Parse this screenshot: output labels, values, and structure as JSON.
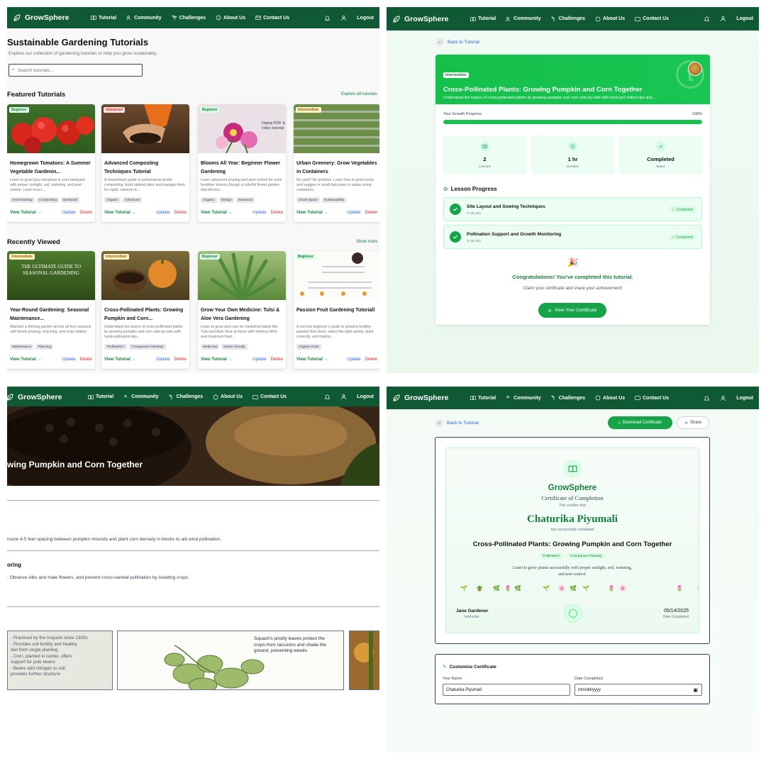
{
  "nav": {
    "brand": "GrowSphere",
    "links": [
      "Tutorial",
      "Community",
      "Challenges",
      "About Us",
      "Contact Us"
    ],
    "logout": "Logout"
  },
  "tutorials_page": {
    "title": "Sustainable Gardening Tutorials",
    "subtitle": "Explore our collection of gardening tutorials to help you grow sustainably.",
    "search_placeholder": "Search tutorials...",
    "featured": {
      "title": "Featured Tutorials",
      "link": "Explore all tutorials",
      "cards": [
        {
          "badge": "Beginner",
          "title": "Homegrown Tomatoes: A Summer Vegetable Gardenin...",
          "desc": "Learn to grow juicy tomatoes in your backyard with proper sunlight, soil, watering, and pest control. Learn how t...",
          "tags": [
            "Seed-starting",
            "Composting",
            "Backyard"
          ]
        },
        {
          "badge": "Advanced",
          "title": "Advanced Composting Techniques Tutorial",
          "desc": "A streamlined guide to professional-grade composting: build optimal piles and manage them for rapid, nutrient-ric...",
          "tags": [
            "Organic",
            "Advanced"
          ]
        },
        {
          "badge": "Beginner",
          "title": "Blooms All Year: Beginner Flower Gardening",
          "desc": "Learn advanced pruning and pest control for even healthier blooms.Design a colorful flower garden that blooms...",
          "tags": [
            "Organic",
            "Design",
            "Seasonal"
          ],
          "image_text": "Digital PDF & video tutorial"
        },
        {
          "badge": "Intermediate",
          "title": "Urban Greenery: Grow Vegetables in Containers",
          "desc": "No yard? No problem. Learn how to grow herbs and veggies in small balconies or patios using containers.",
          "tags": [
            "Small Space",
            "Sustainability"
          ]
        }
      ]
    },
    "recent": {
      "title": "Recently Viewed",
      "link": "Show more",
      "cards": [
        {
          "badge": "Intermediate",
          "title": "Year-Round Gardening: Seasonal Maintenance...",
          "desc": "Maintain a thriving garden across all four seasons with timely pruning, mulching, and crop rotation",
          "tags": [
            "Maintenance",
            "Planning"
          ],
          "image_text": "THE ULTIMATE GUIDE TO SEASONAL GARDENING"
        },
        {
          "badge": "Intermediate",
          "title": "Cross-Pollinated Plants: Growing Pumpkin and Corn...",
          "desc": "Understand the basics of cross-pollinated plants by growing pumpkin and corn side-by-side with hand-pollination tips...",
          "tags": [
            "\"Pollination\"",
            "\"Companion Planting\""
          ]
        },
        {
          "badge": "Beginner",
          "title": "Grow Your Own Medicine: Tulsi & Aloe Vera Gardening",
          "desc": "Learn to grow and care for medicinal plants like Tulsi and Aloe Vera at home with minimal effort and maximum heal...",
          "tags": [
            "Medicinal",
            "Indoor friendly"
          ]
        },
        {
          "badge": "Beginner",
          "title": "Passion Fruit Gardening Tutoriall",
          "desc": "A concise beginner's guide to growing healthy passion fruit vines: select the right variety, plant correctly, and mainta...",
          "tags": [
            "Organic fruits"
          ]
        }
      ]
    },
    "actions": {
      "view": "View Tutorial →",
      "update": "Update",
      "delete": "Delete"
    }
  },
  "tutorial_detail": {
    "back": "Back to Tutorial",
    "level": "Intermediate",
    "title": "Cross-Pollinated Plants: Growing Pumpkin and Corn Together",
    "subtitle": "Understand the basics of cross-pollinated plants by growing pumpkin and corn side-by-side with hand-pol ination tips and...",
    "progress_label": "Your Growth Progress",
    "progress_value": "100%",
    "progress": 1.0,
    "stats": [
      {
        "value": "2",
        "label": "Lessons"
      },
      {
        "value": "1 hr",
        "label": "Duration"
      },
      {
        "value": "Completed",
        "label": "Status"
      }
    ],
    "lesson_progress": "Lesson Progress",
    "lessons": [
      {
        "title": "Site Layout and Sowing Techniques",
        "duration": "25 min",
        "status": "✓ Completed"
      },
      {
        "title": "Pollination Support and Growth Monitoring",
        "duration": "25 min",
        "status": "✓ Completed"
      }
    ],
    "congrats": "Congratulations! You've completed this tutorial.",
    "congrats_sub": "Claim your certificate and share your achievement!",
    "cert_button": "View Your Certificate"
  },
  "lesson_view": {
    "hero_title": "wing Pumpkin and Corn Together",
    "text1": "nsure 4-5 feet spacing between pumpkin mounds and plant corn densely in blocks to aid wind pollination.",
    "heading2": "oring",
    "text2": ". Observe silks and male flowers, and prevent cross-varietal pollination by isolating crops.",
    "illus_left": [
      "- Practiced by the Iroquois since 1300s",
      "- Provides soil fertility and healthy",
      "  diet from single planting",
      "- Corn, planted in center, offers",
      "  support for pole beans",
      "- Beans add nitrogen to soil,",
      "  provides further structure"
    ],
    "illus_mid": "Squash's prickly leaves protect the crops from raccoons and shade the ground, preventing weeds."
  },
  "certificate": {
    "back": "Back to Tutorial",
    "download": "Download Certificate",
    "share": "Share",
    "brand": "GrowSphere",
    "heading": "Certificate of Completion",
    "certifies": "This certifies that",
    "name": "Chaturika Piyumali",
    "completed": "has successfully completed",
    "course": "Cross-Pollinated Plants: Growing Pumpkin and Corn Together",
    "tags": [
      "\"Pollination\"",
      "\"Companion Planting\""
    ],
    "desc_line1": "Learn to grow plants successfully with proper sunlight, soil, watering,",
    "desc_line2": "and pest control.",
    "instructor": "Jane Gardener",
    "instructor_label": "Instructor",
    "date": "05/14/2025",
    "date_label": "Date Completed",
    "customize_title": "Customize Certificate",
    "name_label": "Your Name",
    "name_value": "Chaturika Piyumali",
    "date_field_label": "Date Completed",
    "date_placeholder": "mm/dd/yyyy"
  },
  "colors": {
    "nav": "#0f5a34",
    "accent": "#16a34a",
    "header_green": "#15c04a",
    "danger": "#dc2626",
    "link": "#2563eb"
  }
}
